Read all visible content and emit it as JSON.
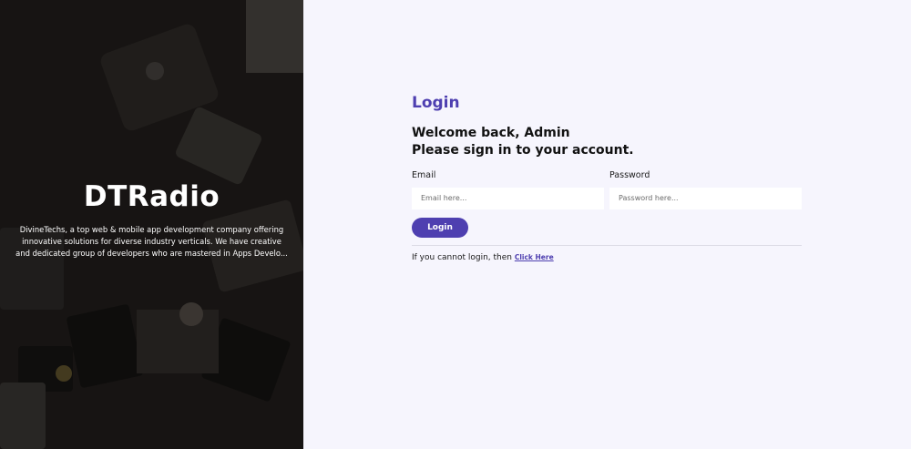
{
  "brand": {
    "title": "DTRadio",
    "description": "DivineTechs, a top web & mobile app development company offering innovative solutions for diverse industry verticals. We have creative and dedicated group of developers who are mastered in Apps Develo..."
  },
  "form": {
    "heading": "Login",
    "welcome_line1": "Welcome back, Admin",
    "welcome_line2": "Please sign in to your account.",
    "email_label": "Email",
    "email_placeholder": "Email here...",
    "email_value": "",
    "password_label": "Password",
    "password_placeholder": "Password here...",
    "password_value": "",
    "login_button": "Login",
    "help_text": "If you cannot login, then",
    "help_link": "Click Here"
  },
  "colors": {
    "accent": "#4e3fb0",
    "background": "#f6f5fd",
    "panel_dark": "#262220"
  }
}
